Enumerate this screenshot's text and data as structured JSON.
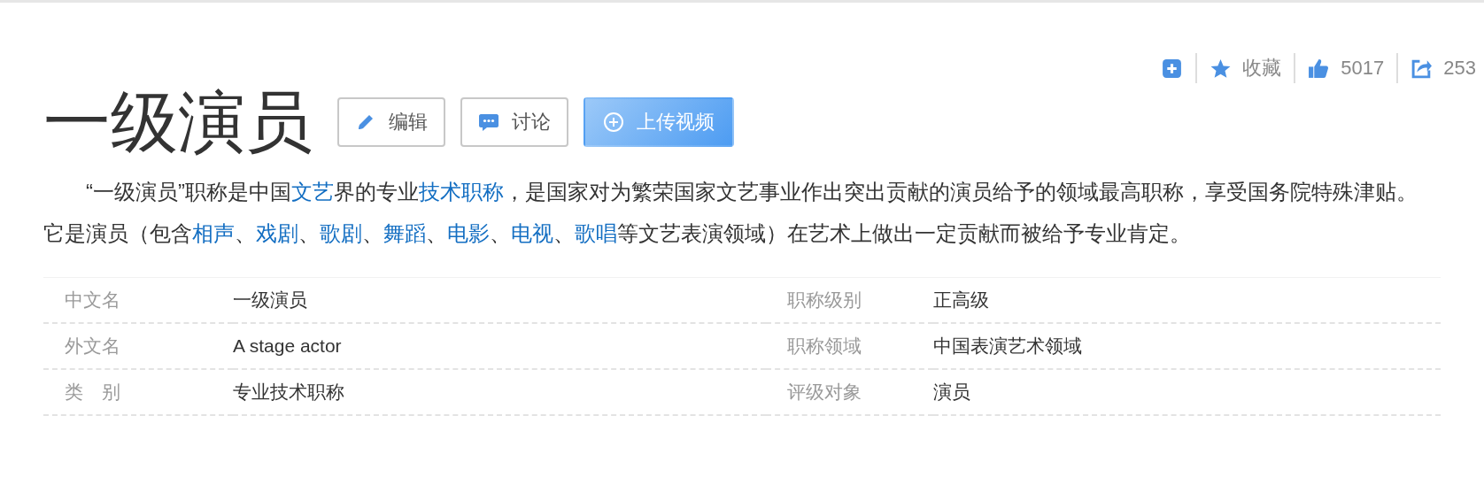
{
  "actions": [
    {
      "kind": "add"
    },
    {
      "kind": "favorite",
      "label": "收藏"
    },
    {
      "kind": "like",
      "label": "5017"
    },
    {
      "kind": "share",
      "label": "253"
    }
  ],
  "title": "一级演员",
  "buttons": [
    {
      "kind": "edit",
      "label": "编辑",
      "primary": false
    },
    {
      "kind": "discuss",
      "label": "讨论",
      "primary": false
    },
    {
      "kind": "upload",
      "label": "上传视频",
      "primary": true
    }
  ],
  "summary": [
    {
      "kind": "text",
      "text": "“一级演员”职称是中国"
    },
    {
      "kind": "link",
      "text": "文艺"
    },
    {
      "kind": "text",
      "text": "界的专业"
    },
    {
      "kind": "link",
      "text": "技术职称"
    },
    {
      "kind": "text",
      "text": "，是国家对为繁荣国家文艺事业作出突出贡献的演员给予的领域最高职称，享受国务院特殊津贴。它是演员（包含"
    },
    {
      "kind": "link",
      "text": "相声"
    },
    {
      "kind": "text",
      "text": "、"
    },
    {
      "kind": "link",
      "text": "戏剧"
    },
    {
      "kind": "text",
      "text": "、"
    },
    {
      "kind": "link",
      "text": "歌剧"
    },
    {
      "kind": "text",
      "text": "、"
    },
    {
      "kind": "link",
      "text": "舞蹈"
    },
    {
      "kind": "text",
      "text": "、"
    },
    {
      "kind": "link",
      "text": "电影"
    },
    {
      "kind": "text",
      "text": "、"
    },
    {
      "kind": "link",
      "text": "电视"
    },
    {
      "kind": "text",
      "text": "、"
    },
    {
      "kind": "link",
      "text": "歌唱"
    },
    {
      "kind": "text",
      "text": "等文艺表演领域）在艺术上做出一定贡献而被给予专业肯定。"
    }
  ],
  "info": [
    {
      "label": "中文名",
      "value": "一级演员"
    },
    {
      "label": "职称级别",
      "value": "正高级"
    },
    {
      "label": "外文名",
      "value": "A stage actor"
    },
    {
      "label": "职称领域",
      "value": "中国表演艺术领域"
    },
    {
      "label": "类　别",
      "value": "专业技术职称"
    },
    {
      "label": "评级对象",
      "value": "演员"
    }
  ]
}
